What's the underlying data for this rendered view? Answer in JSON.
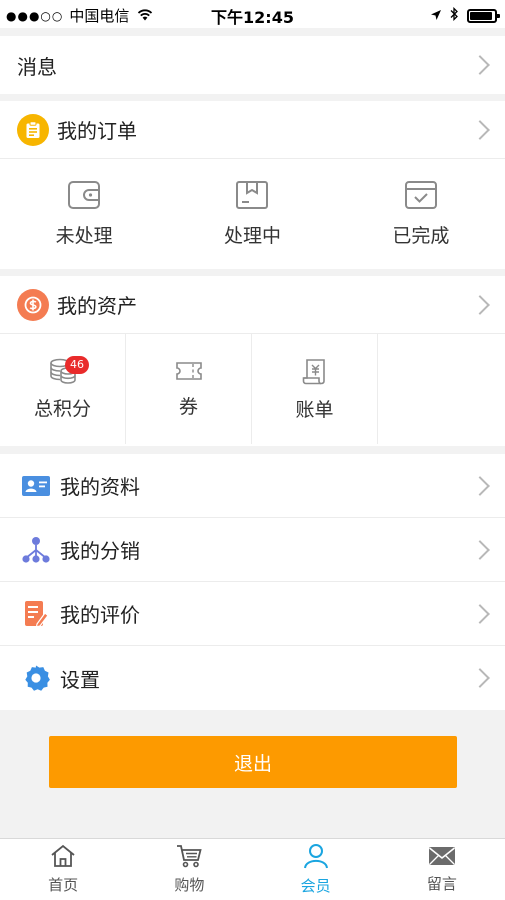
{
  "status": {
    "signal_dots": "●●●○○",
    "carrier": "中国电信",
    "time": "下午12:45"
  },
  "messages": {
    "label": "消息"
  },
  "orders": {
    "title": "我的订单",
    "icon": "clipboard-icon",
    "color": "#f7b500",
    "items": [
      {
        "label": "未处理",
        "icon": "wallet-icon"
      },
      {
        "label": "处理中",
        "icon": "package-box-icon"
      },
      {
        "label": "已完成",
        "icon": "check-box-icon"
      }
    ]
  },
  "assets": {
    "title": "我的资产",
    "icon": "dollar-icon",
    "color": "#f47c52",
    "items": [
      {
        "label": "总积分",
        "icon": "coins-icon",
        "badge": "46"
      },
      {
        "label": "券",
        "icon": "ticket-icon"
      },
      {
        "label": "账单",
        "icon": "bill-scroll-icon"
      }
    ]
  },
  "menu": [
    {
      "label": "我的资料",
      "icon": "profile-card-icon"
    },
    {
      "label": "我的分销",
      "icon": "distribution-tree-icon"
    },
    {
      "label": "我的评价",
      "icon": "review-edit-icon"
    },
    {
      "label": "设置",
      "icon": "gear-icon"
    }
  ],
  "logout_label": "退出",
  "tabs": [
    {
      "label": "首页",
      "icon": "home-icon",
      "active": false
    },
    {
      "label": "购物",
      "icon": "cart-icon",
      "active": false
    },
    {
      "label": "会员",
      "icon": "member-icon",
      "active": true
    },
    {
      "label": "留言",
      "icon": "mail-icon",
      "active": false
    }
  ],
  "colors": {
    "accent_orange": "#fd9a00",
    "tab_active": "#1aa5e0",
    "badge_red": "#e92b2b"
  }
}
